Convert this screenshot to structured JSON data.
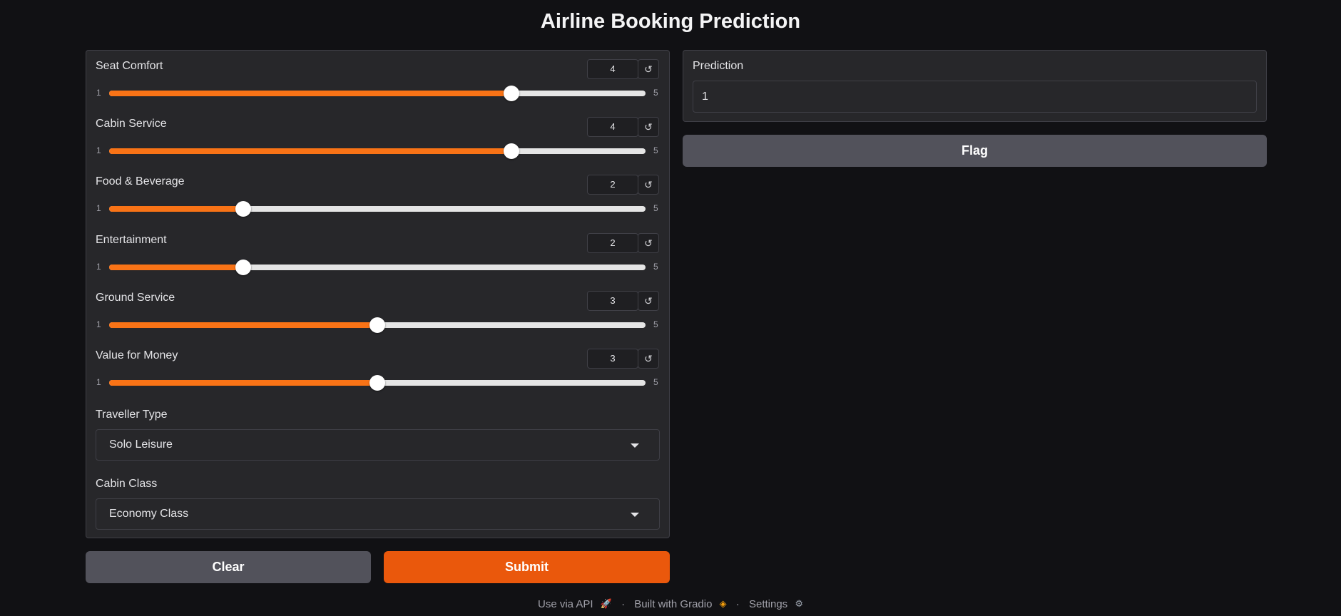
{
  "page": {
    "title": "Airline Booking Prediction"
  },
  "sliders": [
    {
      "label": "Seat Comfort",
      "value": "4",
      "min": "1",
      "max": "5",
      "reset_icon": "reset-icon"
    },
    {
      "label": "Cabin Service",
      "value": "4",
      "min": "1",
      "max": "5",
      "reset_icon": "reset-icon"
    },
    {
      "label": "Food & Beverage",
      "value": "2",
      "min": "1",
      "max": "5",
      "reset_icon": "reset-icon"
    },
    {
      "label": "Entertainment",
      "value": "2",
      "min": "1",
      "max": "5",
      "reset_icon": "reset-icon"
    },
    {
      "label": "Ground Service",
      "value": "3",
      "min": "1",
      "max": "5",
      "reset_icon": "reset-icon"
    },
    {
      "label": "Value for Money",
      "value": "3",
      "min": "1",
      "max": "5",
      "reset_icon": "reset-icon"
    }
  ],
  "dropdowns": [
    {
      "label": "Traveller Type",
      "value": "Solo Leisure"
    },
    {
      "label": "Cabin Class",
      "value": "Economy Class"
    }
  ],
  "output": {
    "label": "Prediction",
    "value": "1"
  },
  "buttons": {
    "flag": "Flag",
    "clear": "Clear",
    "submit": "Submit"
  },
  "footer": {
    "api": "Use via API",
    "built": "Built with Gradio",
    "settings": "Settings",
    "separator": "·"
  },
  "colors": {
    "accent": "#f97316",
    "submit": "#ea580c",
    "secondary_button": "#52525b",
    "panel": "#27272a",
    "background": "#111114"
  }
}
